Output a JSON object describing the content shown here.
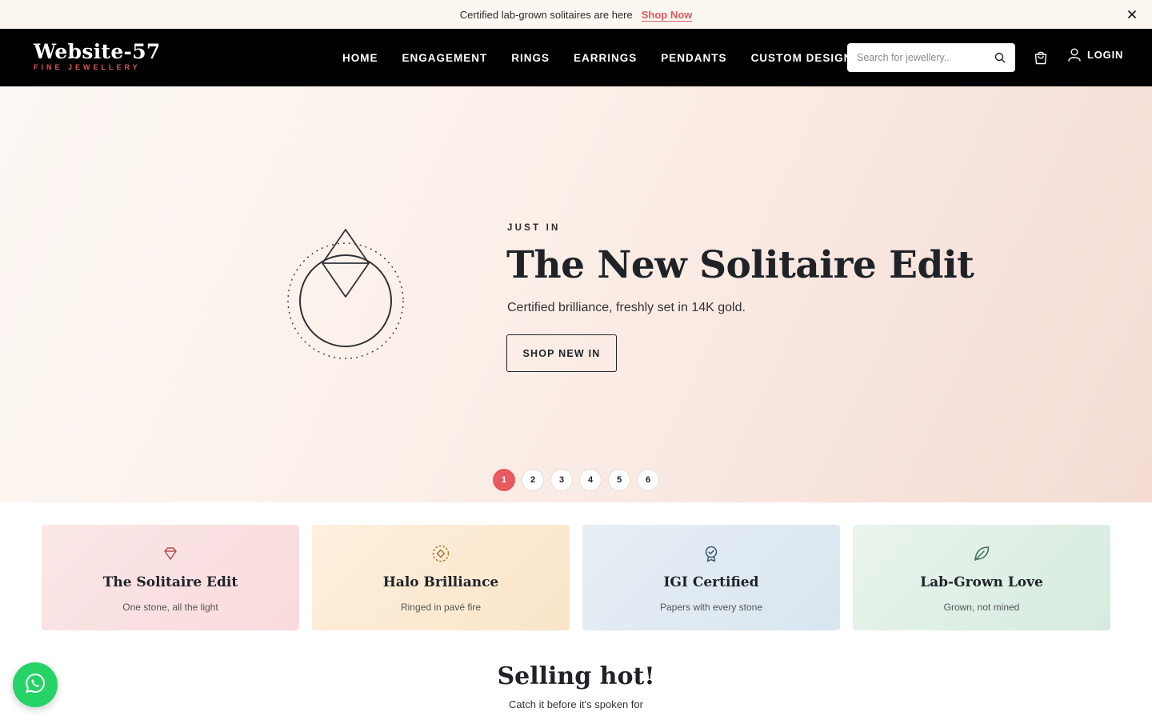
{
  "announcement": {
    "message": "Certified lab-grown solitaires are here",
    "cta": "Shop Now",
    "close_icon": "close-icon"
  },
  "header": {
    "logo_name": "Website-57",
    "logo_tagline": "FINE JEWELLERY",
    "nav": [
      "HOME",
      "ENGAGEMENT",
      "RINGS",
      "EARRINGS",
      "PENDANTS",
      "CUSTOM DESIGN"
    ],
    "search": {
      "placeholder": "Search for jewellery..",
      "icon": "search-icon"
    },
    "cart_icon": "shopping-bag-icon",
    "login": {
      "label": "LOGIN",
      "icon": "user-icon"
    }
  },
  "hero": {
    "eyebrow": "JUST IN",
    "title": "The New Solitaire Edit",
    "subtitle": "Certified brilliance, freshly set in 14K gold.",
    "button": "SHOP NEW IN",
    "art_icon": "solitaire-ring-icon",
    "slides": [
      "1",
      "2",
      "3",
      "4",
      "5",
      "6"
    ],
    "active_slide": "1"
  },
  "feature_cards": [
    {
      "title": "The Solitaire Edit",
      "subtitle": "One stone, all the light",
      "icon": "diamond-icon"
    },
    {
      "title": "Halo Brilliance",
      "subtitle": "Ringed in pavé fire",
      "icon": "halo-icon"
    },
    {
      "title": "IGI Certified",
      "subtitle": "Papers with every stone",
      "icon": "certificate-badge-icon"
    },
    {
      "title": "Lab-Grown Love",
      "subtitle": "Grown, not mined",
      "icon": "leaf-icon"
    }
  ],
  "section": {
    "title": "Selling hot!",
    "subtitle": "Catch it before it's spoken for"
  },
  "floating": {
    "whatsapp_icon": "whatsapp-icon"
  },
  "colors": {
    "accent": "#e0585d",
    "header_bg": "#000000",
    "whatsapp": "#25d366",
    "card_backgrounds": [
      "#fbe3e3",
      "#fcecd6",
      "#e2ebf3",
      "#e3f1e8"
    ],
    "card_icon_colors": [
      "#b84c4c",
      "#a4762f",
      "#3b5670",
      "#3f6e52"
    ]
  }
}
